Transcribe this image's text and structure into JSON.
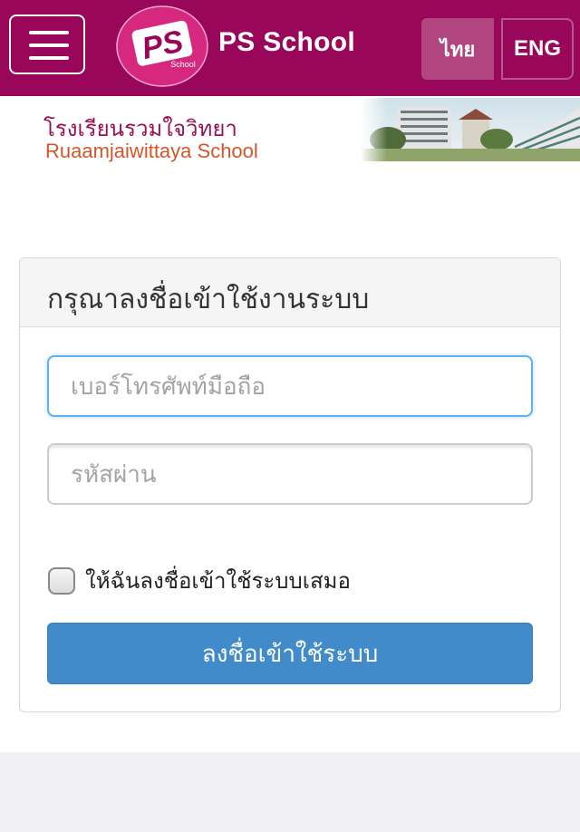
{
  "header": {
    "menu_icon": "hamburger-menu-icon",
    "logo_text": "School",
    "brand_name": "PS School",
    "languages": [
      {
        "label": "ไทย",
        "active": true
      },
      {
        "label": "ENG",
        "active": false
      }
    ],
    "colors": {
      "bar": "#98075a",
      "logo_bg": "#d7287f",
      "active_lang": "#b1457f"
    }
  },
  "banner": {
    "school_name_th": "โรงเรียนรวมใจวิทยา",
    "school_name_en": "Ruaamjaiwittaya School"
  },
  "login": {
    "title": "กรุณาลงชื่อเข้าใช้งานระบบ",
    "phone_placeholder": "เบอร์โทรศัพท์มือถือ",
    "password_placeholder": "รหัสผ่าน",
    "remember_label": "ให้ฉันลงชื่อเข้าใช้ระบบเสมอ",
    "remember_checked": false,
    "submit_label": "ลงชื่อเข้าใช้ระบบ",
    "colors": {
      "submit": "#428bca",
      "focus_border": "#66afe9"
    }
  }
}
